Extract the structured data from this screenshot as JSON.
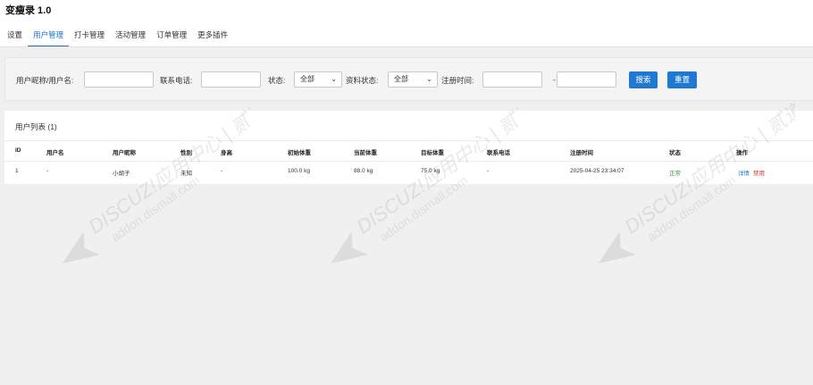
{
  "app": {
    "title": "变瘦录 1.0"
  },
  "tabs": [
    {
      "label": "设置",
      "active": false
    },
    {
      "label": "用户管理",
      "active": true
    },
    {
      "label": "打卡管理",
      "active": false
    },
    {
      "label": "活动管理",
      "active": false
    },
    {
      "label": "订单管理",
      "active": false
    },
    {
      "label": "更多插件",
      "active": false
    }
  ],
  "filters": {
    "name_label": "用户昵称/用户名:",
    "name_value": "",
    "phone_label": "联系电话:",
    "phone_value": "",
    "status_label": "状态:",
    "status_value": "全部",
    "profile_status_label": "资料状态:",
    "profile_status_value": "全部",
    "register_time_label": "注册时间:",
    "register_time_start": "",
    "range_separator": "-",
    "register_time_end": "",
    "search_button": "搜索",
    "reset_button": "重置"
  },
  "list": {
    "title": "用户列表 (1)",
    "columns": [
      "ID",
      "用户名",
      "用户昵称",
      "性别",
      "身高",
      "初始体重",
      "当前体重",
      "目标体重",
      "联系电话",
      "注册时间",
      "状态",
      "操作"
    ],
    "rows": [
      {
        "id": "1",
        "username": "-",
        "nickname": "小胡子",
        "gender": "未知",
        "height": "-",
        "initial_weight": "100.0 kg",
        "current_weight": "88.0 kg",
        "target_weight": "75.0 kg",
        "phone": "-",
        "register_time": "2025-04-25 23:34:07",
        "status": "正常",
        "action_edit": "详情",
        "action_ban": "禁用"
      }
    ]
  },
  "watermark": {
    "line1": "DISCUZ!应用中心 | 贰道",
    "line2": "addon.dismall.com"
  },
  "colors": {
    "accent": "#1f78d1",
    "status_ok": "#2e9c3d",
    "danger": "#d9342b"
  }
}
